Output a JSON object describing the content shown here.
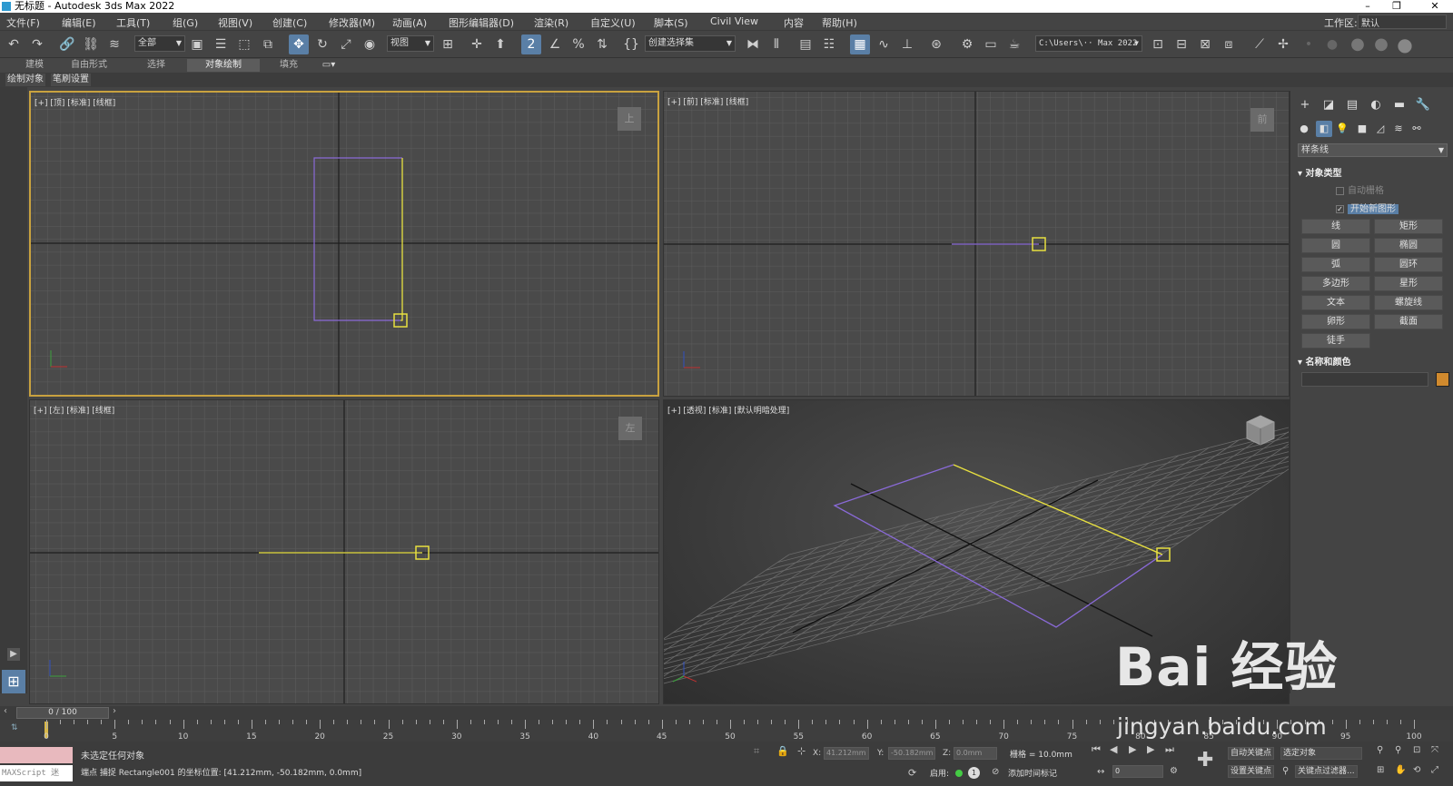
{
  "window": {
    "title": "无标题 - Autodesk 3ds Max 2022"
  },
  "menu": [
    "文件(F)",
    "编辑(E)",
    "工具(T)",
    "组(G)",
    "视图(V)",
    "创建(C)",
    "修改器(M)",
    "动画(A)",
    "图形编辑器(D)",
    "渲染(R)",
    "自定义(U)",
    "脚本(S)",
    "Civil View",
    "内容",
    "帮助(H)"
  ],
  "workspace": {
    "label": "工作区:",
    "value": "默认"
  },
  "toolbar": {
    "selection_filter": "全部",
    "ref_coord": "视图",
    "named_selection": "创建选择集",
    "project_path": "C:\\Users\\·· Max 2022",
    "snap_label": "2"
  },
  "ribbon": {
    "tabs": [
      "建模",
      "自由形式",
      "选择",
      "对象绘制",
      "填充"
    ],
    "active_tab": "对象绘制",
    "sub": [
      "绘制对象",
      "笔刷设置"
    ]
  },
  "viewports": [
    {
      "label": "[+] [顶] [标准] [线框]",
      "cube": "上"
    },
    {
      "label": "[+] [前] [标准] [线框]",
      "cube": "前"
    },
    {
      "label": "[+] [左] [标准] [线框]",
      "cube": "左"
    },
    {
      "label": "[+] [透视] [标准] [默认明暗处理]",
      "cube": ""
    }
  ],
  "command_panel": {
    "category": "样条线",
    "object_type_title": "对象类型",
    "auto_grid": "自动栅格",
    "start_new_shape": "开始新图形",
    "buttons": [
      "线",
      "矩形",
      "圆",
      "椭圆",
      "弧",
      "圆环",
      "多边形",
      "星形",
      "文本",
      "螺旋线",
      "卵形",
      "截面",
      "徒手"
    ],
    "name_color_title": "名称和颜色",
    "color": "#d08a2e"
  },
  "timeline": {
    "frame_display": "0 / 100",
    "ticks": [
      0,
      5,
      10,
      15,
      20,
      25,
      30,
      35,
      40,
      45,
      50,
      55,
      60,
      65,
      70,
      75,
      80,
      85,
      90,
      95,
      100
    ]
  },
  "status": {
    "maxscript": "MAXScript 迷",
    "selection": "未选定任何对象",
    "prompt": "端点 捕捉 Rectangle001 的坐标位置: [41.212mm, -50.182mm, 0.0mm]",
    "x_label": "X:",
    "x": "41.212mm",
    "y_label": "Y:",
    "y": "-50.182mm",
    "z_label": "Z:",
    "z": "0.0mm",
    "grid": "栅格 = 10.0mm",
    "enable": "启用:",
    "add_time_tag": "添加时间标记",
    "auto_key": "自动关键点",
    "selected_object": "选定对象",
    "set_key": "设置关键点",
    "key_filters": "关键点过滤器...",
    "frame": "0"
  },
  "watermark": {
    "line1": "Bai 经验",
    "line2": "jingyan.baidu.com"
  }
}
